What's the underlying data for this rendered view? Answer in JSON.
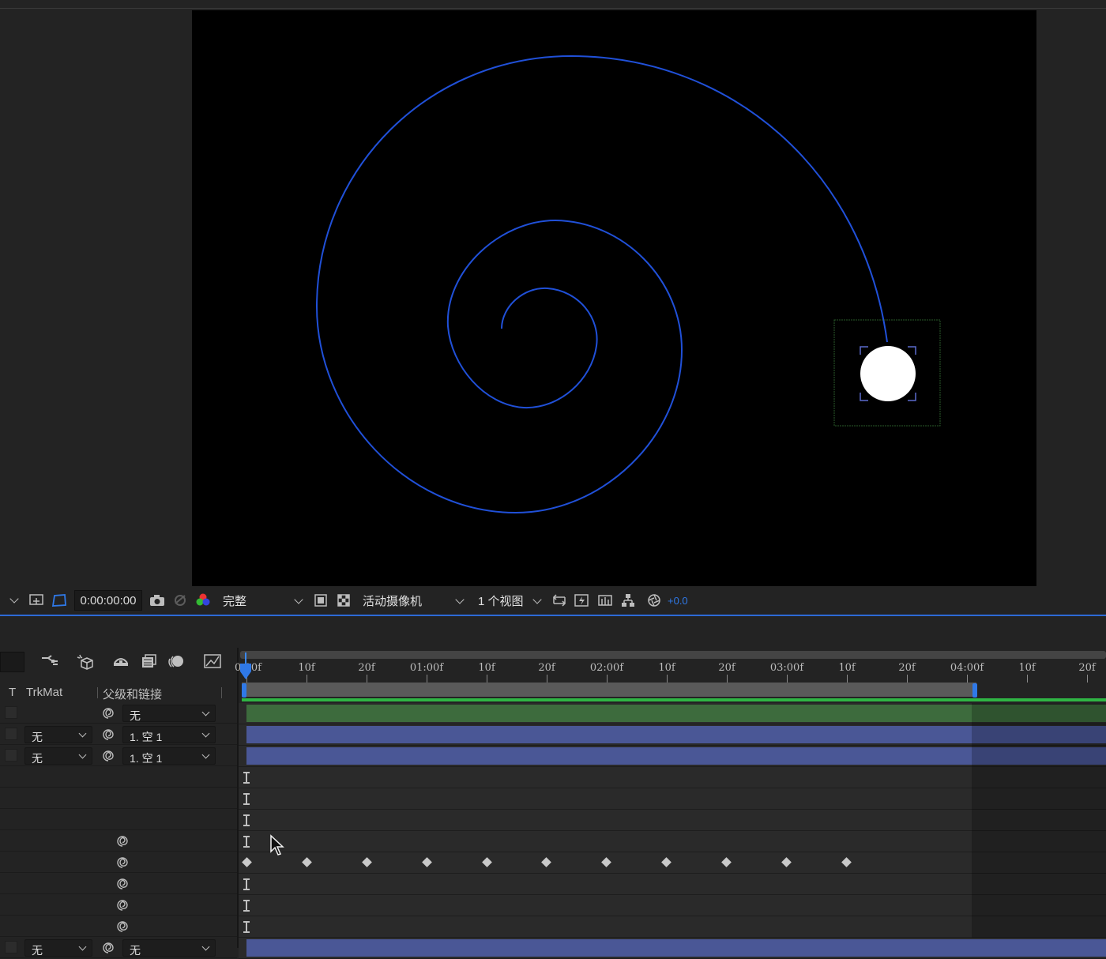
{
  "viewer": {
    "toolbar": {
      "timecode": "0:00:00:00",
      "resolution": "完整",
      "camera": "活动摄像机",
      "views": "1 个视图",
      "exposure": "+0.0",
      "exposure_color": "#2f79e8"
    },
    "canvas": {
      "background": "#000000",
      "path_color": "#2050d8",
      "ball_color": "#ffffff"
    }
  },
  "timeline": {
    "columns": {
      "t": "T",
      "trkmat": "TrkMat",
      "parent": "父级和链接"
    },
    "ruler_labels": [
      "0:00f",
      "10f",
      "20f",
      "01:00f",
      "10f",
      "20f",
      "02:00f",
      "10f",
      "20f",
      "03:00f",
      "10f",
      "20f",
      "04:00f",
      "10f",
      "20f"
    ],
    "layers": [
      {
        "trkmat": "",
        "parent": "无",
        "bar": "green"
      },
      {
        "trkmat": "无",
        "parent": "1. 空 1",
        "bar": "blue"
      },
      {
        "trkmat": "无",
        "parent": "1. 空 1",
        "bar": "blue"
      }
    ],
    "bottom_layer": {
      "trkmat": "无",
      "parent": "无"
    }
  }
}
